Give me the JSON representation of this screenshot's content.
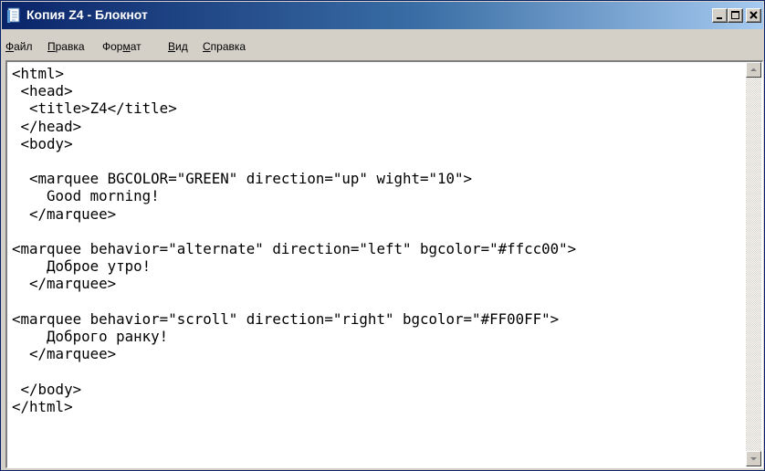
{
  "window": {
    "title": "Копия Z4 - Блокнот",
    "titlebar_gradient": [
      "#0a246a",
      "#a6caf0"
    ]
  },
  "menu": {
    "file": {
      "accel": "Ф",
      "rest": "айл"
    },
    "edit": {
      "accel": "П",
      "rest": "равка"
    },
    "format": {
      "pre": "Фор",
      "accel": "м",
      "rest": "ат"
    },
    "view": {
      "accel": "В",
      "rest": "ид"
    },
    "help": {
      "accel": "С",
      "rest": "правка"
    }
  },
  "editor": {
    "lines": [
      "<html>",
      " <head>",
      "  <title>Z4</title>",
      " </head>",
      " <body>",
      "",
      "  <marquee BGCOLOR=\"GREEN\" direction=\"up\" wight=\"10\">",
      "    Good morning!",
      "  </marquee>",
      "",
      "<marquee behavior=\"alternate\" direction=\"left\" bgcolor=\"#ffcc00\">",
      "    Доброе утро!",
      "  </marquee>",
      "",
      "<marquee behavior=\"scroll\" direction=\"right\" bgcolor=\"#FF00FF\">",
      "    Доброго ранку!",
      "  </marquee>",
      "",
      " </body>",
      "</html>"
    ]
  },
  "icons": {
    "app": "notepad-icon",
    "minimize": "minimize-icon",
    "maximize": "maximize-icon",
    "close": "close-icon",
    "scroll_up": "arrow-up-icon",
    "scroll_down": "arrow-down-icon"
  }
}
